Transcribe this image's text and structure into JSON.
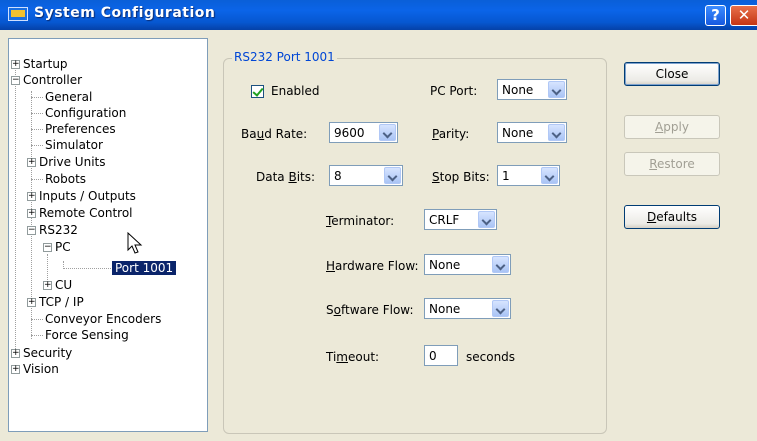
{
  "window": {
    "title": "System Configuration",
    "help_glyph": "?",
    "close_glyph": "✕"
  },
  "tree": {
    "startup": "Startup",
    "controller": "Controller",
    "general": "General",
    "configuration": "Configuration",
    "preferences": "Preferences",
    "simulator": "Simulator",
    "drive_units": "Drive Units",
    "robots": "Robots",
    "inputs_outputs": "Inputs / Outputs",
    "remote_control": "Remote Control",
    "rs232": "RS232",
    "pc": "PC",
    "port_1001": "Port 1001",
    "cu": "CU",
    "tcp_ip": "TCP / IP",
    "conveyor_encoders": "Conveyor Encoders",
    "force_sensing": "Force Sensing",
    "security": "Security",
    "vision": "Vision",
    "expand_glyph": "+",
    "collapse_glyph": "−"
  },
  "panel": {
    "group_title": "RS232 Port 1001",
    "enabled_label": "Enabled",
    "enabled_checked": true,
    "pc_port_label": "PC Port:",
    "pc_port_value": "None",
    "baud_rate_pre": "Ba",
    "baud_rate_u": "u",
    "baud_rate_post": "d Rate:",
    "baud_rate_value": "9600",
    "parity_u": "P",
    "parity_post": "arity:",
    "parity_value": "None",
    "data_bits_pre": "Data ",
    "data_bits_u": "B",
    "data_bits_post": "its:",
    "data_bits_value": "8",
    "stop_bits_u": "S",
    "stop_bits_post": "top Bits:",
    "stop_bits_value": "1",
    "terminator_u": "T",
    "terminator_post": "erminator:",
    "terminator_value": "CRLF",
    "hardware_flow_u": "H",
    "hardware_flow_post": "ardware Flow:",
    "hardware_flow_value": "None",
    "software_flow_pre": "S",
    "software_flow_u": "o",
    "software_flow_post": "ftware Flow:",
    "software_flow_value": "None",
    "timeout_pre": "Ti",
    "timeout_u": "m",
    "timeout_post": "eout:",
    "timeout_value": "0",
    "timeout_unit": "seconds"
  },
  "buttons": {
    "close": "Close",
    "apply_u": "A",
    "apply_post": "pply",
    "restore_u": "R",
    "restore_post": "estore",
    "defaults_u": "D",
    "defaults_post": "efaults"
  },
  "colors": {
    "title_bar": "#0B64E8",
    "selection": "#0A246A",
    "group_title": "#0046D5"
  }
}
